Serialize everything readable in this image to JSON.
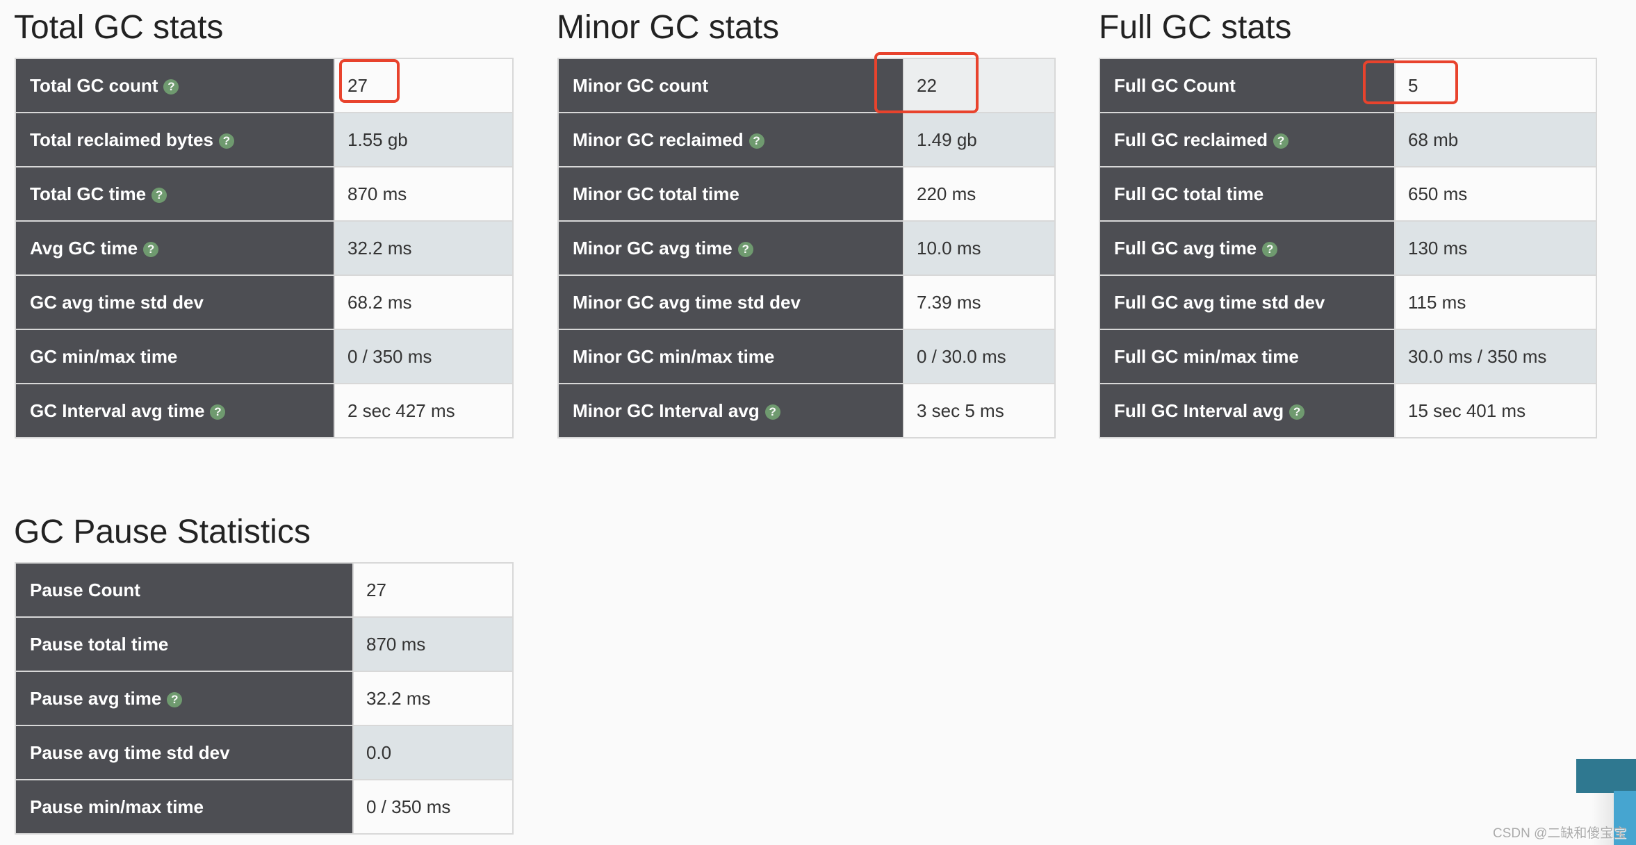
{
  "total": {
    "title": "Total GC stats",
    "rows": [
      {
        "label": "Total GC count",
        "value": "27",
        "help": true
      },
      {
        "label": "Total reclaimed bytes",
        "value": "1.55 gb",
        "help": true
      },
      {
        "label": "Total GC time",
        "value": "870 ms",
        "help": true
      },
      {
        "label": "Avg GC time",
        "value": "32.2 ms",
        "help": true
      },
      {
        "label": "GC avg time std dev",
        "value": "68.2 ms",
        "help": false
      },
      {
        "label": "GC min/max time",
        "value": "0 / 350 ms",
        "help": false
      },
      {
        "label": "GC Interval avg time",
        "value": "2 sec 427 ms",
        "help": true
      }
    ]
  },
  "minor": {
    "title": "Minor GC stats",
    "rows": [
      {
        "label": "Minor GC count",
        "value": "22",
        "help": false
      },
      {
        "label": "Minor GC reclaimed",
        "value": "1.49 gb",
        "help": true
      },
      {
        "label": "Minor GC total time",
        "value": "220 ms",
        "help": false
      },
      {
        "label": "Minor GC avg time",
        "value": "10.0 ms",
        "help": true
      },
      {
        "label": "Minor GC avg time std dev",
        "value": "7.39 ms",
        "help": false
      },
      {
        "label": "Minor GC min/max time",
        "value": "0 / 30.0 ms",
        "help": false
      },
      {
        "label": "Minor GC Interval avg",
        "value": "3 sec 5 ms",
        "help": true
      }
    ]
  },
  "full": {
    "title": "Full GC stats",
    "rows": [
      {
        "label": "Full GC Count",
        "value": "5",
        "help": false
      },
      {
        "label": "Full GC reclaimed",
        "value": "68 mb",
        "help": true
      },
      {
        "label": "Full GC total time",
        "value": "650 ms",
        "help": false
      },
      {
        "label": "Full GC avg time",
        "value": "130 ms",
        "help": true
      },
      {
        "label": "Full GC avg time std dev",
        "value": "115 ms",
        "help": false
      },
      {
        "label": "Full GC min/max time",
        "value": "30.0 ms / 350 ms",
        "help": false
      },
      {
        "label": "Full GC Interval avg",
        "value": "15 sec 401 ms",
        "help": true
      }
    ]
  },
  "pause": {
    "title": "GC Pause Statistics",
    "rows": [
      {
        "label": "Pause Count",
        "value": "27",
        "help": false
      },
      {
        "label": "Pause total time",
        "value": "870 ms",
        "help": false
      },
      {
        "label": "Pause avg time",
        "value": "32.2 ms",
        "help": true
      },
      {
        "label": "Pause avg time std dev",
        "value": "0.0",
        "help": false
      },
      {
        "label": "Pause min/max time",
        "value": "0 / 350 ms",
        "help": false
      }
    ]
  },
  "help_icon": "question-circle-icon",
  "help_glyph": "?",
  "colors": {
    "label_bg": "#4d4e53",
    "row_alt": "#dde3e6",
    "help": "#6f9a6f",
    "annotation": "#e8432d"
  },
  "watermark": "CSDN @二缺和傻宝宝"
}
